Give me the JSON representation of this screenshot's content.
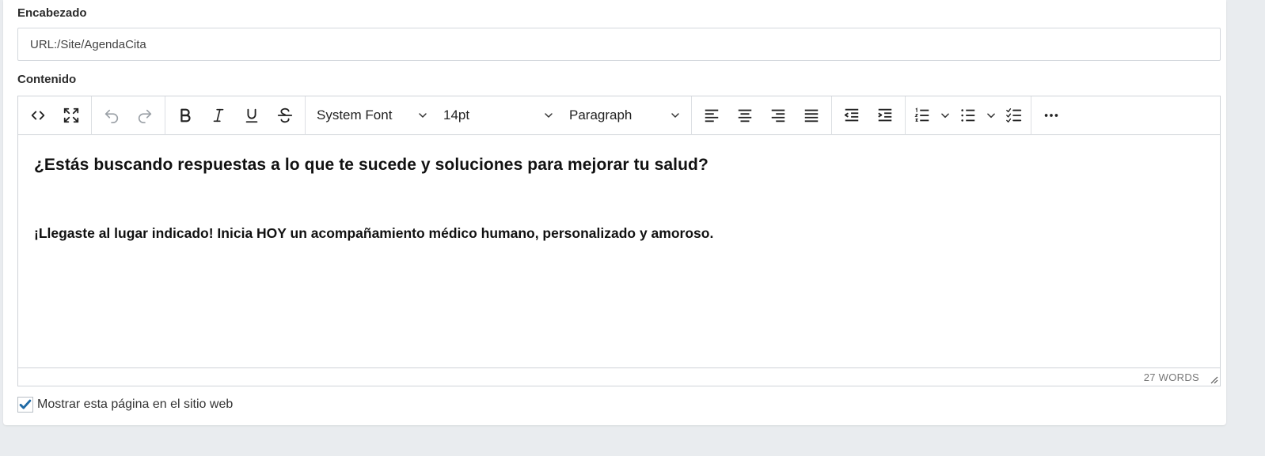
{
  "form": {
    "header_label": "Encabezado",
    "header_value": "URL:/Site/AgendaCita",
    "content_label": "Contenido",
    "show_on_site_label": "Mostrar esta página en el sitio web",
    "show_on_site_checked": true
  },
  "toolbar": {
    "font_family": "System Font",
    "font_size": "14pt",
    "block_format": "Paragraph",
    "icons": [
      "code-icon",
      "fullscreen-icon",
      "undo-icon",
      "redo-icon",
      "bold-icon",
      "italic-icon",
      "underline-icon",
      "strikethrough-icon",
      "align-left-icon",
      "align-center-icon",
      "align-right-icon",
      "align-justify-icon",
      "outdent-icon",
      "indent-icon",
      "numbered-list-icon",
      "bullet-list-icon",
      "checklist-icon",
      "more-icon"
    ]
  },
  "editor": {
    "heading": "¿Estás buscando respuestas a lo que te sucede y soluciones para mejorar tu salud?",
    "paragraph": "¡Llegaste al lugar indicado! Inicia HOY un acompañamiento médico humano, personalizado y amoroso.",
    "word_count": "27 WORDS"
  },
  "colors": {
    "page_bg": "#e9ecef",
    "checkbox_accent": "#1f6aa5"
  }
}
